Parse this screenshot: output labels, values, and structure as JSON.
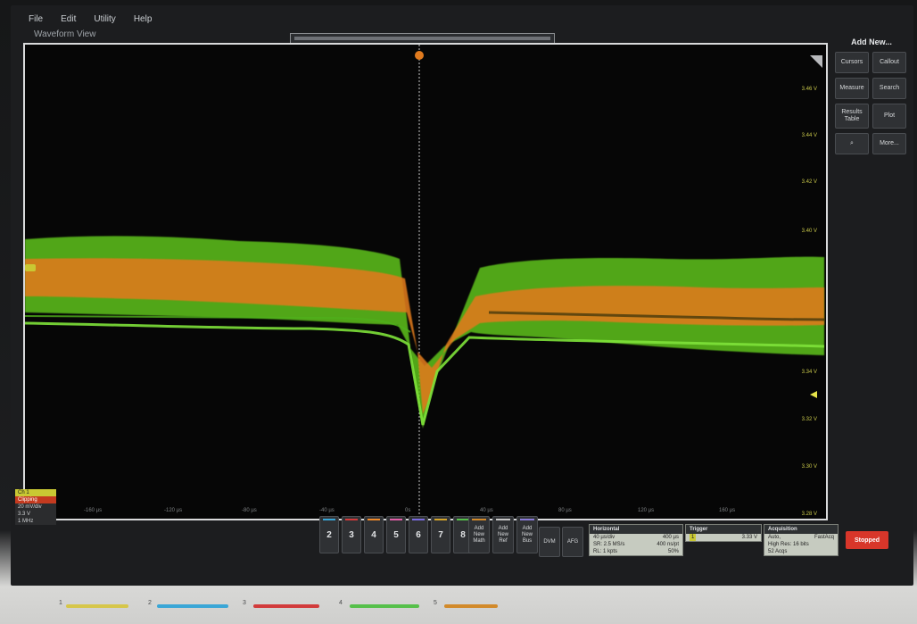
{
  "menu": {
    "items": [
      "File",
      "Edit",
      "Utility",
      "Help"
    ]
  },
  "waveform_view": {
    "title": "Waveform View",
    "volt_labels": [
      "3.46 V",
      "3.44 V",
      "3.42 V",
      "3.40 V",
      "3.34 V",
      "3.32 V",
      "3.30 V",
      "3.28 V"
    ],
    "time_labels": [
      "-160 µs",
      "-120 µs",
      "-80 µs",
      "-40 µs",
      "0s",
      "40 µs",
      "80 µs",
      "120 µs",
      "160 µs"
    ]
  },
  "channel_badge": {
    "title": "Ch 1",
    "status": "Clipping",
    "scale": "20 mV/div",
    "offset": "3.3 V",
    "bw": "1 MHz"
  },
  "sidebar": {
    "header": "Add New...",
    "buttons": [
      "Cursors",
      "Callout",
      "Measure",
      "Search",
      "Results Table",
      "Plot",
      "More..."
    ]
  },
  "channels": {
    "buttons": [
      "2",
      "3",
      "4",
      "5",
      "6",
      "7",
      "8"
    ],
    "colors": [
      "#3aa6d6",
      "#d23b3b",
      "#f08a2a",
      "#e25fa8",
      "#7a6be0",
      "#d4a52b",
      "#56c04a"
    ]
  },
  "add_buttons": [
    {
      "label": "Add New Math",
      "color": "#d28a2a"
    },
    {
      "label": "Add New Ref",
      "color": "#c7c7c7"
    },
    {
      "label": "Add New Bus",
      "color": "#8a7bd8"
    }
  ],
  "tools": [
    "DVM",
    "AFG"
  ],
  "horizontal": {
    "title": "Horizontal",
    "rows": [
      [
        "40 µs/div",
        "400 µs"
      ],
      [
        "SR: 2.5 MS/s",
        "400 ns/pt"
      ],
      [
        "RL: 1 kpts",
        "50%"
      ]
    ]
  },
  "trigger": {
    "title": "Trigger",
    "channel": "1",
    "level": "3.33 V"
  },
  "acquisition": {
    "title": "Acquisition",
    "rows": [
      [
        "Auto,",
        "FastAcq"
      ],
      [
        "High Res: 16 bits",
        ""
      ],
      [
        "52 Acqs",
        ""
      ]
    ]
  },
  "run_state": "Stopped",
  "front_keys": {
    "numbers": [
      "1",
      "2",
      "3",
      "4",
      "5"
    ],
    "colors": [
      "#d6c64a",
      "#3aa6d6",
      "#d23b3b",
      "#56c04a",
      "#d28a2a"
    ]
  },
  "colors": {
    "trace_green": "#6fe02a",
    "trace_orange": "#e07a1e",
    "volt_label": "#c9c84a"
  }
}
